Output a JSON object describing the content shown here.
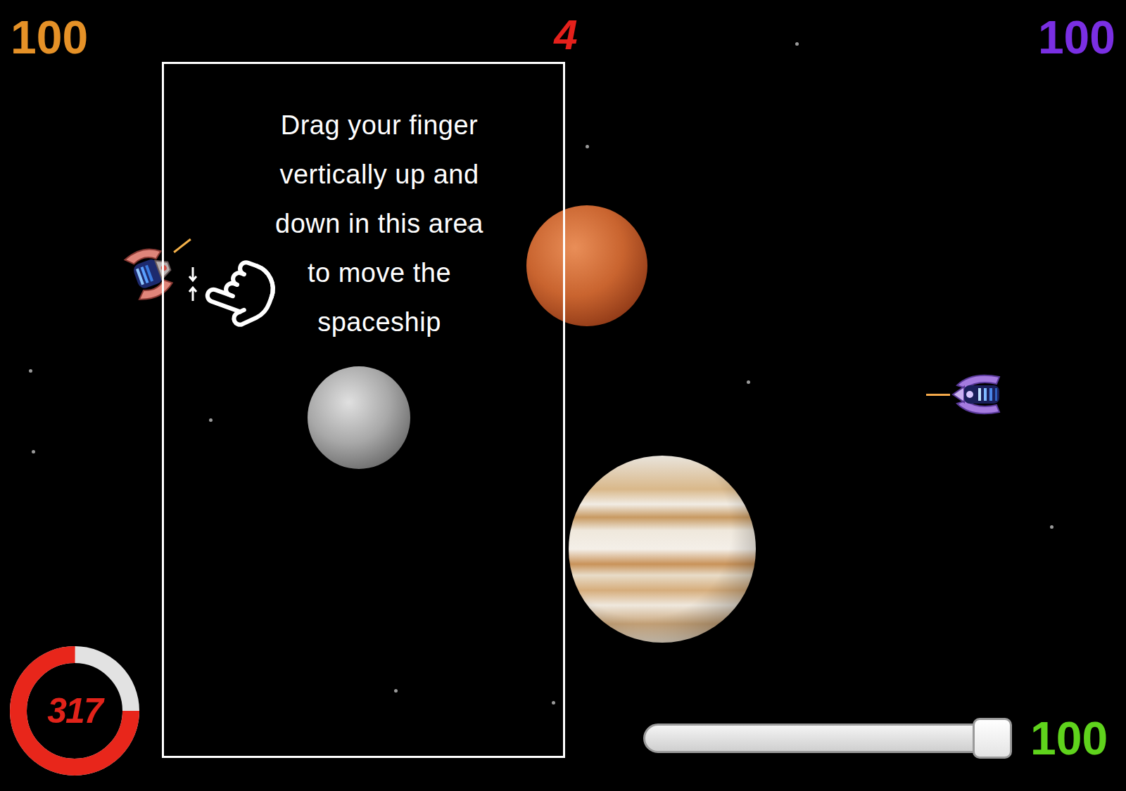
{
  "scores": [
    {
      "text": "100",
      "color": "#e59127"
    },
    {
      "text": "100",
      "color": "#7a2fe3"
    }
  ],
  "round": "4",
  "tutorial": {
    "lines": [
      "Drag your finger",
      "vertically up and",
      "down in this area",
      "to move the",
      "spaceship"
    ]
  },
  "timer": {
    "text": "317",
    "level": 0.75
  },
  "throttle": {
    "level": 1,
    "reading": "100"
  }
}
